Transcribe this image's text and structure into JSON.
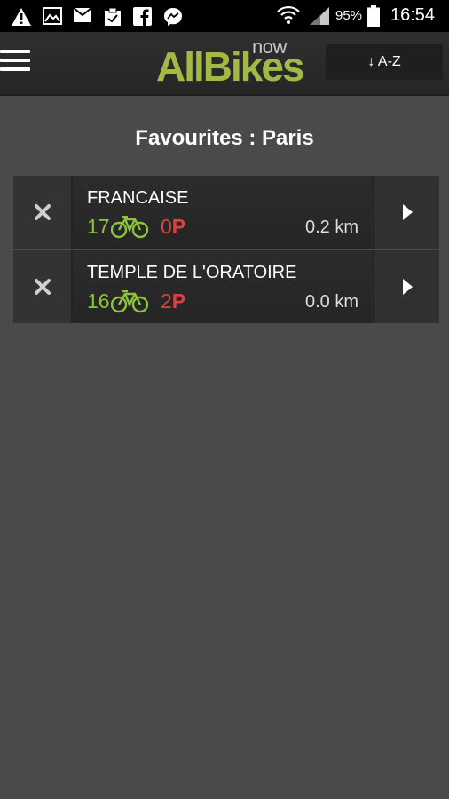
{
  "status_bar": {
    "icons": [
      "warning-icon",
      "gallery-icon",
      "mail-icon",
      "clipboard-icon",
      "facebook-icon",
      "messenger-icon",
      "wifi-icon",
      "signal-icon",
      "battery-icon"
    ],
    "battery": "95%",
    "time": "16:54"
  },
  "app_bar": {
    "logo_main": "AllBikes",
    "logo_sub": "now",
    "sort_label": "↓ A-Z"
  },
  "page_title": "Favourites : Paris",
  "favourites": [
    {
      "name": "FRANCAISE",
      "bikes": "17",
      "parking": "0",
      "parking_symbol": "P",
      "distance": "0.2 km"
    },
    {
      "name": "TEMPLE DE L'ORATOIRE",
      "bikes": "16",
      "parking": "2",
      "parking_symbol": "P",
      "distance": "0.0 km"
    }
  ],
  "colors": {
    "background": "#4a4a4a",
    "bikes": "#8cc43b",
    "parking": "#e04040",
    "logo": "#a3b945"
  }
}
